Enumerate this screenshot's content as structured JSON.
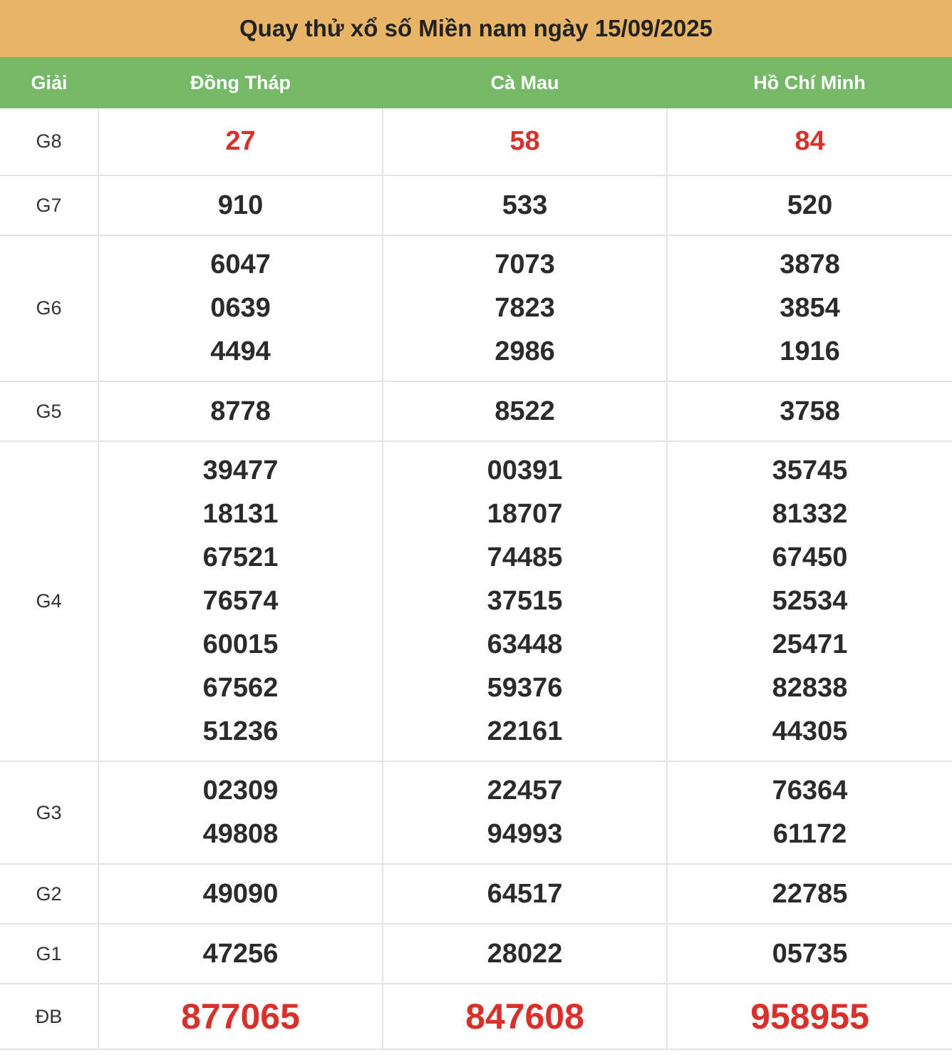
{
  "title": "Quay thử xổ số Miền nam ngày 15/09/2025",
  "headers": {
    "prize": "Giải",
    "provinces": [
      "Đồng Tháp",
      "Cà Mau",
      "Hồ Chí Minh"
    ]
  },
  "colors": {
    "title_bg": "#e8b466",
    "header_bg": "#74b868",
    "highlight": "#d8302a",
    "number": "#2b2b2b"
  },
  "rows": [
    {
      "prize": "G8",
      "highlight": true,
      "values": [
        [
          "27"
        ],
        [
          "58"
        ],
        [
          "84"
        ]
      ]
    },
    {
      "prize": "G7",
      "highlight": false,
      "values": [
        [
          "910"
        ],
        [
          "533"
        ],
        [
          "520"
        ]
      ]
    },
    {
      "prize": "G6",
      "highlight": false,
      "values": [
        [
          "6047",
          "0639",
          "4494"
        ],
        [
          "7073",
          "7823",
          "2986"
        ],
        [
          "3878",
          "3854",
          "1916"
        ]
      ]
    },
    {
      "prize": "G5",
      "highlight": false,
      "values": [
        [
          "8778"
        ],
        [
          "8522"
        ],
        [
          "3758"
        ]
      ]
    },
    {
      "prize": "G4",
      "highlight": false,
      "values": [
        [
          "39477",
          "18131",
          "67521",
          "76574",
          "60015",
          "67562",
          "51236"
        ],
        [
          "00391",
          "18707",
          "74485",
          "37515",
          "63448",
          "59376",
          "22161"
        ],
        [
          "35745",
          "81332",
          "67450",
          "52534",
          "25471",
          "82838",
          "44305"
        ]
      ]
    },
    {
      "prize": "G3",
      "highlight": false,
      "values": [
        [
          "02309",
          "49808"
        ],
        [
          "22457",
          "94993"
        ],
        [
          "76364",
          "61172"
        ]
      ]
    },
    {
      "prize": "G2",
      "highlight": false,
      "values": [
        [
          "49090"
        ],
        [
          "64517"
        ],
        [
          "22785"
        ]
      ]
    },
    {
      "prize": "G1",
      "highlight": false,
      "values": [
        [
          "47256"
        ],
        [
          "28022"
        ],
        [
          "05735"
        ]
      ]
    },
    {
      "prize": "ĐB",
      "highlight": true,
      "special": true,
      "values": [
        [
          "877065"
        ],
        [
          "847608"
        ],
        [
          "958955"
        ]
      ]
    }
  ]
}
